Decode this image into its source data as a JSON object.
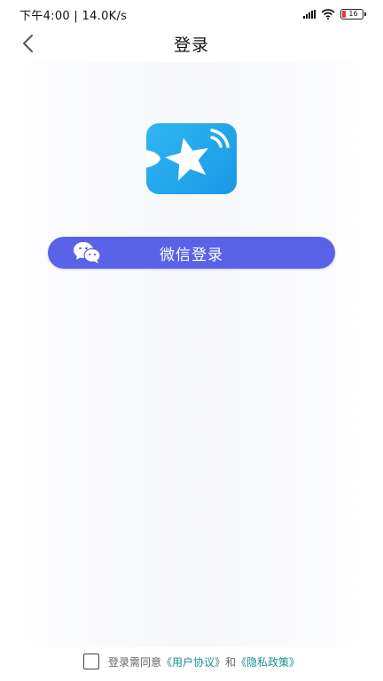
{
  "status_bar": {
    "time_speed": "下午4:00 | 14.0K/s",
    "battery": "16",
    "battery_color": "#e53935"
  },
  "nav": {
    "back_icon": "chevron-left-icon",
    "title": "登录"
  },
  "logo": {
    "icon": "star-signal-app-logo",
    "color": "#1a98e6"
  },
  "wechat_login": {
    "icon": "wechat-icon",
    "label": "微信登录",
    "color": "#5a62e8"
  },
  "agreement": {
    "prefix": "登录需同意",
    "user_agreement": "《用户协议》",
    "and": "和",
    "privacy_policy": "《隐私政策》",
    "link_color": "#1a8f8a"
  }
}
